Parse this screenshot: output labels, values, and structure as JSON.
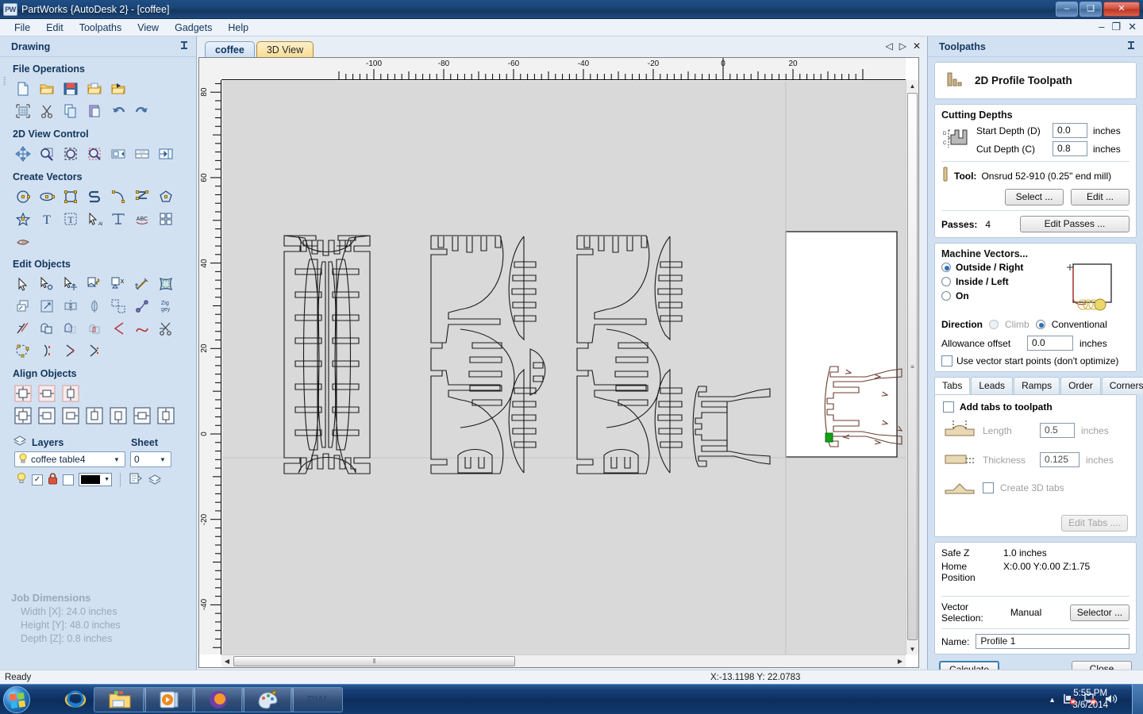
{
  "window": {
    "title": "PartWorks {AutoDesk 2} - [coffee]",
    "app_badge": "PW",
    "minimize": "–",
    "maximize": "❑",
    "close": "✕"
  },
  "menu": {
    "items": [
      "File",
      "Edit",
      "Toolpaths",
      "View",
      "Gadgets",
      "Help"
    ]
  },
  "mdi": {
    "minimize": "–",
    "restore": "❐",
    "close": "✕"
  },
  "left_panel": {
    "title": "Drawing",
    "pin": "➤",
    "sections": [
      {
        "title": "File Operations",
        "rows": [
          [
            "new-file-icon",
            "open-folder-icon",
            "save-icon",
            "import-icon",
            "export-icon"
          ],
          [
            "job-setup-icon",
            "cut-icon",
            "copy-icon",
            "paste-icon",
            "undo-icon",
            "redo-icon"
          ]
        ]
      },
      {
        "title": "2D View Control",
        "rows": [
          [
            "pan-icon",
            "zoom-in-icon",
            "zoom-extents-icon",
            "zoom-box-icon",
            "zoom-selected-icon",
            "zoom-drawing-icon",
            "toggle-panel-icon"
          ]
        ]
      },
      {
        "title": "Create Vectors",
        "rows": [
          [
            "circle-icon",
            "ellipse-icon",
            "rectangle-icon",
            "polyline-icon",
            "arc-icon",
            "polygon-icon",
            "star-icon"
          ],
          [
            "star-tool-icon",
            "text-icon",
            "text-box-icon",
            "text-selection-icon",
            "text-on-curve-icon",
            "text-arc-icon",
            "grid-array-icon"
          ],
          [
            "trace-bitmap-icon"
          ]
        ]
      },
      {
        "title": "Edit Objects",
        "rows": [
          [
            "select-icon",
            "node-edit-icon",
            "move-icon",
            "group-icon",
            "ungroup-icon",
            "measure-icon",
            "distort-icon"
          ],
          [
            "offset-icon",
            "scale-icon",
            "mirror-icon",
            "fold-icon",
            "copy-array-icon",
            "join-vectors-icon",
            "nest-icon"
          ],
          [
            "trim-icon",
            "weld-icon",
            "subtract-icon",
            "intersect-icon",
            "fillet-icon",
            "curve-fit-icon",
            "cut-vectors-icon"
          ],
          [
            "node-points-icon",
            "open-vector-icon",
            "close-vector-icon",
            "reverse-vector-icon"
          ]
        ]
      },
      {
        "title": "Align Objects",
        "rows": [
          [
            "align-center-icon",
            "align-center-h-icon",
            "align-center-v-icon"
          ],
          [
            "align-all-icon",
            "align-left-icon",
            "align-right-icon",
            "align-top-icon",
            "align-bottom-icon",
            "align-middle-h-icon",
            "align-middle-v-icon"
          ]
        ]
      }
    ],
    "layers": {
      "title": "Layers",
      "sheet_label": "Sheet",
      "selected_layer": "coffee table4",
      "sheet_value": "0",
      "visible_icon": "lightbulb-icon",
      "checkbox_checked": "✓",
      "lock_icon": "lock-icon",
      "color_swatch": "#000000",
      "layer_props_icon": "layer-properties-icon",
      "merge_layers_icon": "merge-layers-icon"
    },
    "job_dimensions": {
      "title": "Job Dimensions",
      "width": "Width  [X]: 24.0 inches",
      "height": "Height [Y]: 48.0 inches",
      "depth": "Depth  [Z]: 0.8 inches"
    }
  },
  "document": {
    "tabs": [
      {
        "label": "coffee",
        "active": true
      },
      {
        "label": "3D View",
        "active": false
      }
    ],
    "tab_nav": {
      "prev": "◁",
      "next": "▷",
      "close": "✕"
    },
    "ruler_h_labels": [
      "-100",
      "-80",
      "-60",
      "-40",
      "-20",
      "0",
      "20"
    ],
    "ruler_v_labels": [
      "80",
      "60",
      "40",
      "20",
      "0",
      "-20",
      "-40"
    ],
    "scrollbar_h": {
      "left_arrow": "◀",
      "right_arrow": "▶",
      "grip": "‖"
    },
    "scrollbar_v": {
      "up_arrow": "▲",
      "down_arrow": "▼",
      "grip": "≡"
    }
  },
  "toolpaths": {
    "panel_title": "Toolpaths",
    "pin": "➤",
    "header": {
      "icon": "end-mill-icon",
      "title": "2D Profile Toolpath"
    },
    "cutting_depths": {
      "group_label": "Cutting Depths",
      "diagram_icon": "depth-profile-icon",
      "start_depth_label": "Start Depth (D)",
      "start_depth_value": "0.0",
      "start_depth_units": "inches",
      "cut_depth_label": "Cut Depth (C)",
      "cut_depth_value": "0.8",
      "cut_depth_units": "inches"
    },
    "tool": {
      "label": "Tool:",
      "value": "Onsrud 52-910 (0.25\" end mill)",
      "select_button": "Select ...",
      "edit_button": "Edit ..."
    },
    "passes": {
      "label": "Passes:",
      "value": "4",
      "edit_button": "Edit Passes ..."
    },
    "machine_vectors": {
      "group_label": "Machine Vectors...",
      "options": [
        {
          "label": "Outside / Right",
          "selected": true
        },
        {
          "label": "Inside / Left",
          "selected": false
        },
        {
          "label": "On",
          "selected": false
        }
      ],
      "direction_label": "Direction",
      "direction_options": [
        {
          "label": "Climb",
          "selected": false
        },
        {
          "label": "Conventional",
          "selected": true
        }
      ],
      "allowance_label": "Allowance offset",
      "allowance_value": "0.0",
      "allowance_units": "inches",
      "start_points_label": "Use vector start points (don't optimize)",
      "start_points_checked": false
    },
    "tabstrip": [
      {
        "label": "Tabs",
        "active": true
      },
      {
        "label": "Leads",
        "active": false
      },
      {
        "label": "Ramps",
        "active": false
      },
      {
        "label": "Order",
        "active": false
      },
      {
        "label": "Corners",
        "active": false
      }
    ],
    "tabs_panel": {
      "add_tabs_label": "Add tabs to toolpath",
      "add_tabs_checked": false,
      "length_label": "Length",
      "length_value": "0.5",
      "length_units": "inches",
      "thickness_label": "Thickness",
      "thickness_value": "0.125",
      "thickness_units": "inches",
      "create_3d_label": "Create 3D tabs",
      "create_3d_checked": false,
      "edit_tabs_button": "Edit Tabs ...."
    },
    "positions": {
      "safe_z_label": "Safe Z",
      "safe_z_value": "1.0 inches",
      "home_label": "Home Position",
      "home_value": "X:0.00 Y:0.00 Z:1.75"
    },
    "vector_selection": {
      "label": "Vector Selection:",
      "value": "Manual",
      "selector_button": "Selector ..."
    },
    "name": {
      "label": "Name:",
      "value": "Profile 1"
    },
    "actions": {
      "calculate": "Calculate",
      "close": "Close"
    }
  },
  "statusbar": {
    "message": "Ready",
    "coordinates": "X:-13.1198 Y: 22.0783"
  },
  "taskbar": {
    "start": "windows-start-icon",
    "items": [
      {
        "name": "internet-explorer-icon",
        "boxed": false
      },
      {
        "name": "file-explorer-icon",
        "boxed": true
      },
      {
        "name": "media-player-icon",
        "boxed": true
      },
      {
        "name": "browser-icon",
        "boxed": true
      },
      {
        "name": "paint-icon",
        "boxed": true
      },
      {
        "name": "partworks-icon",
        "boxed": true,
        "label": "PW"
      }
    ],
    "tray": {
      "expand": "▲",
      "network_icon": "network-error-icon",
      "display_icon": "display-error-icon",
      "volume_icon": "volume-icon"
    },
    "clock_time": "5:55 PM",
    "clock_date": "3/6/2014"
  }
}
